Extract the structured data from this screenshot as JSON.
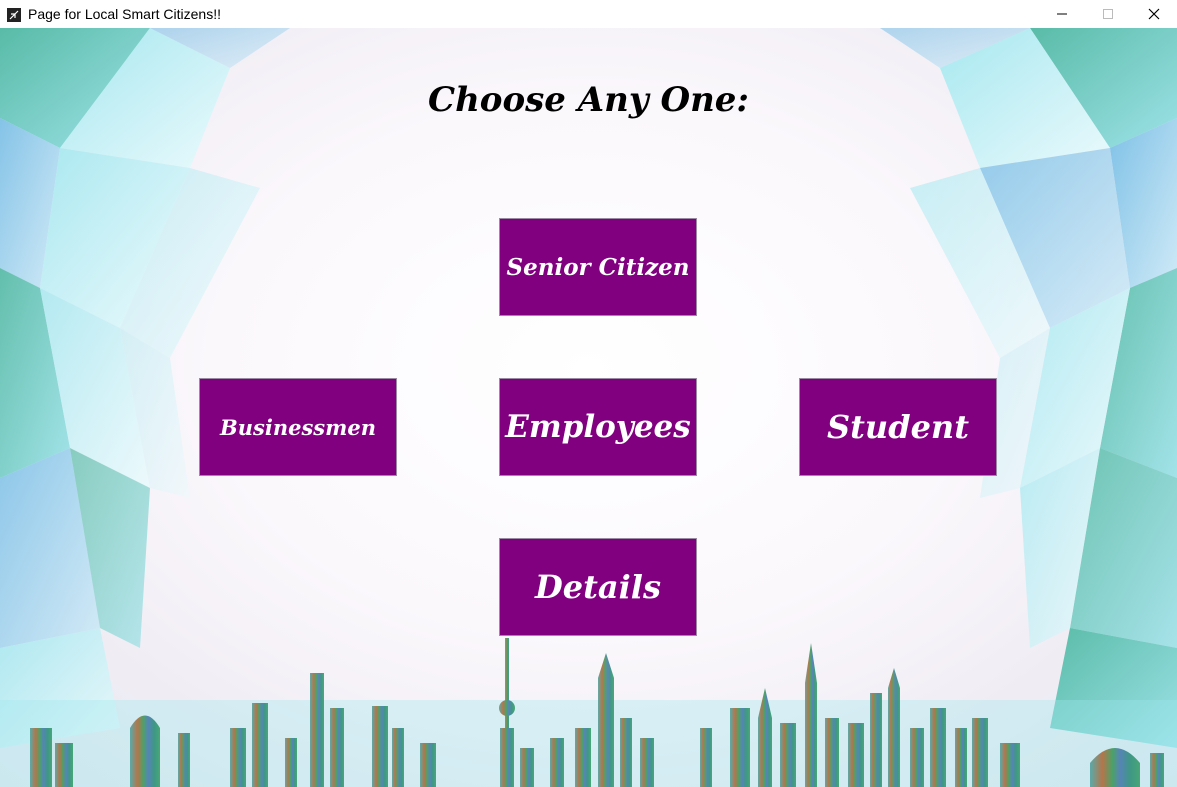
{
  "window": {
    "title": "Page for Local Smart Citizens!!",
    "icon": "feather-app-icon",
    "controls": [
      "minimize-icon",
      "maximize-icon",
      "close-icon"
    ]
  },
  "main": {
    "heading": "Choose Any One:",
    "buttons": {
      "senior": "Senior Citizen",
      "business": "Businessmen",
      "employees": "Employees",
      "student": "Student",
      "details": "Details"
    }
  },
  "colors": {
    "button_bg": "#800080",
    "button_text": "#ffffff",
    "crystal_accent": "#5fd0d8",
    "skyline_green": "#2f8f5f"
  }
}
